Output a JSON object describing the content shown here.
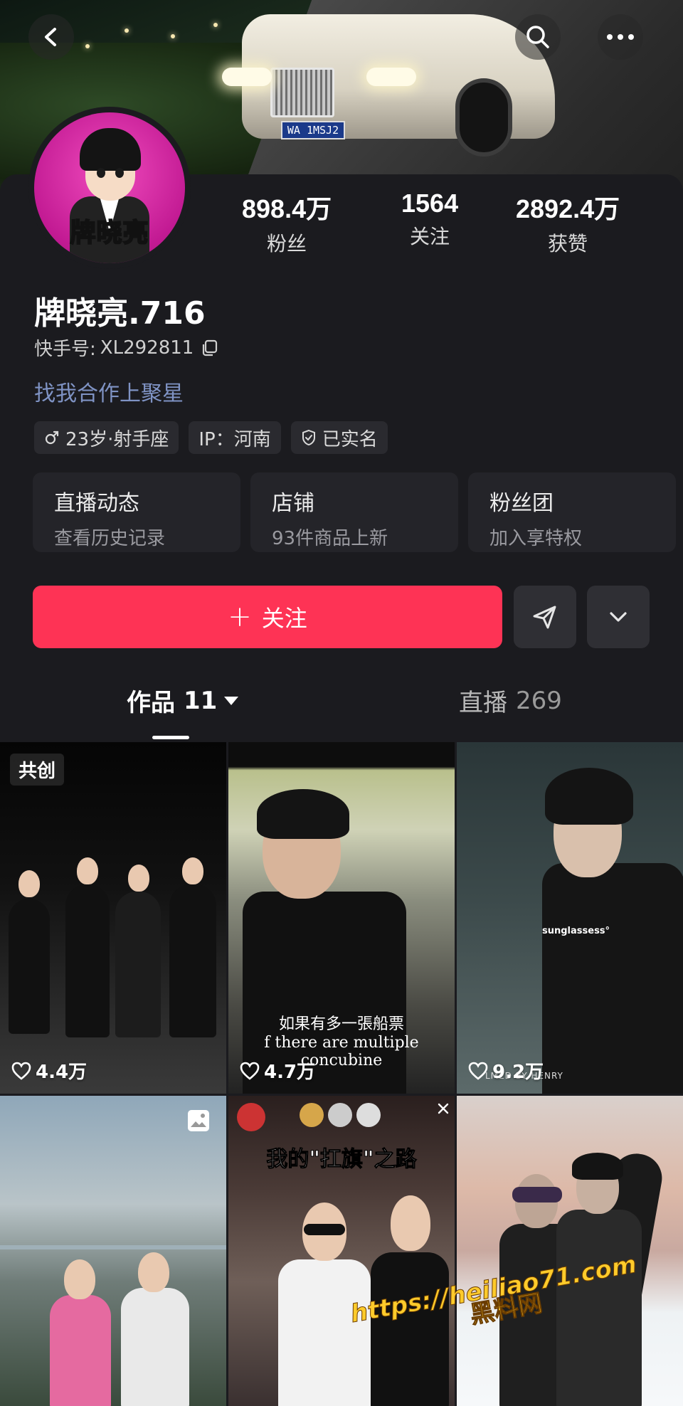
{
  "cover": {
    "plate_text": "WA 1MSJ2"
  },
  "profile": {
    "avatar_text": "牌晓亮",
    "nickname": "牌晓亮.716",
    "kuaishou_id_label": "快手号:",
    "kuaishou_id": "XL292811",
    "bio_link": "找我合作上聚星"
  },
  "stats": [
    {
      "value": "898.4万",
      "label": "粉丝"
    },
    {
      "value": "1564",
      "label": "关注"
    },
    {
      "value": "2892.4万",
      "label": "获赞"
    }
  ],
  "tags": {
    "age": "23岁·射手座",
    "ip": "IP：河南",
    "verified": "已实名"
  },
  "entries": [
    {
      "title": "直播动态",
      "sub": "查看历史记录"
    },
    {
      "title": "店铺",
      "sub": "93件商品上新"
    },
    {
      "title": "粉丝团",
      "sub": "加入享特权"
    }
  ],
  "actions": {
    "follow_label": "关注",
    "follow_plus": "+"
  },
  "tabs": {
    "works_label": "作品",
    "works_count": "11",
    "live_label": "直播",
    "live_count": "269"
  },
  "tiles": [
    {
      "likes": "4.4万",
      "badge": "共创"
    },
    {
      "likes": "4.7万",
      "subtitle_cn": "如果有多一張船票",
      "subtitle_en": "f there are multiple concubine"
    },
    {
      "likes": "9.2万",
      "overlay_text": "sunglassess°",
      "footer_text": "LMED BY HENRY"
    },
    {
      "likes": ""
    },
    {
      "likes": "",
      "overlay_text": "我的\"扛旗\"之路"
    },
    {
      "likes": ""
    }
  ],
  "watermark": {
    "url": "https://heiliao71.com",
    "name": "黑料网"
  },
  "colors": {
    "accent": "#fe3355",
    "bio_link": "#7f93c4",
    "background": "#1b1b1f"
  }
}
